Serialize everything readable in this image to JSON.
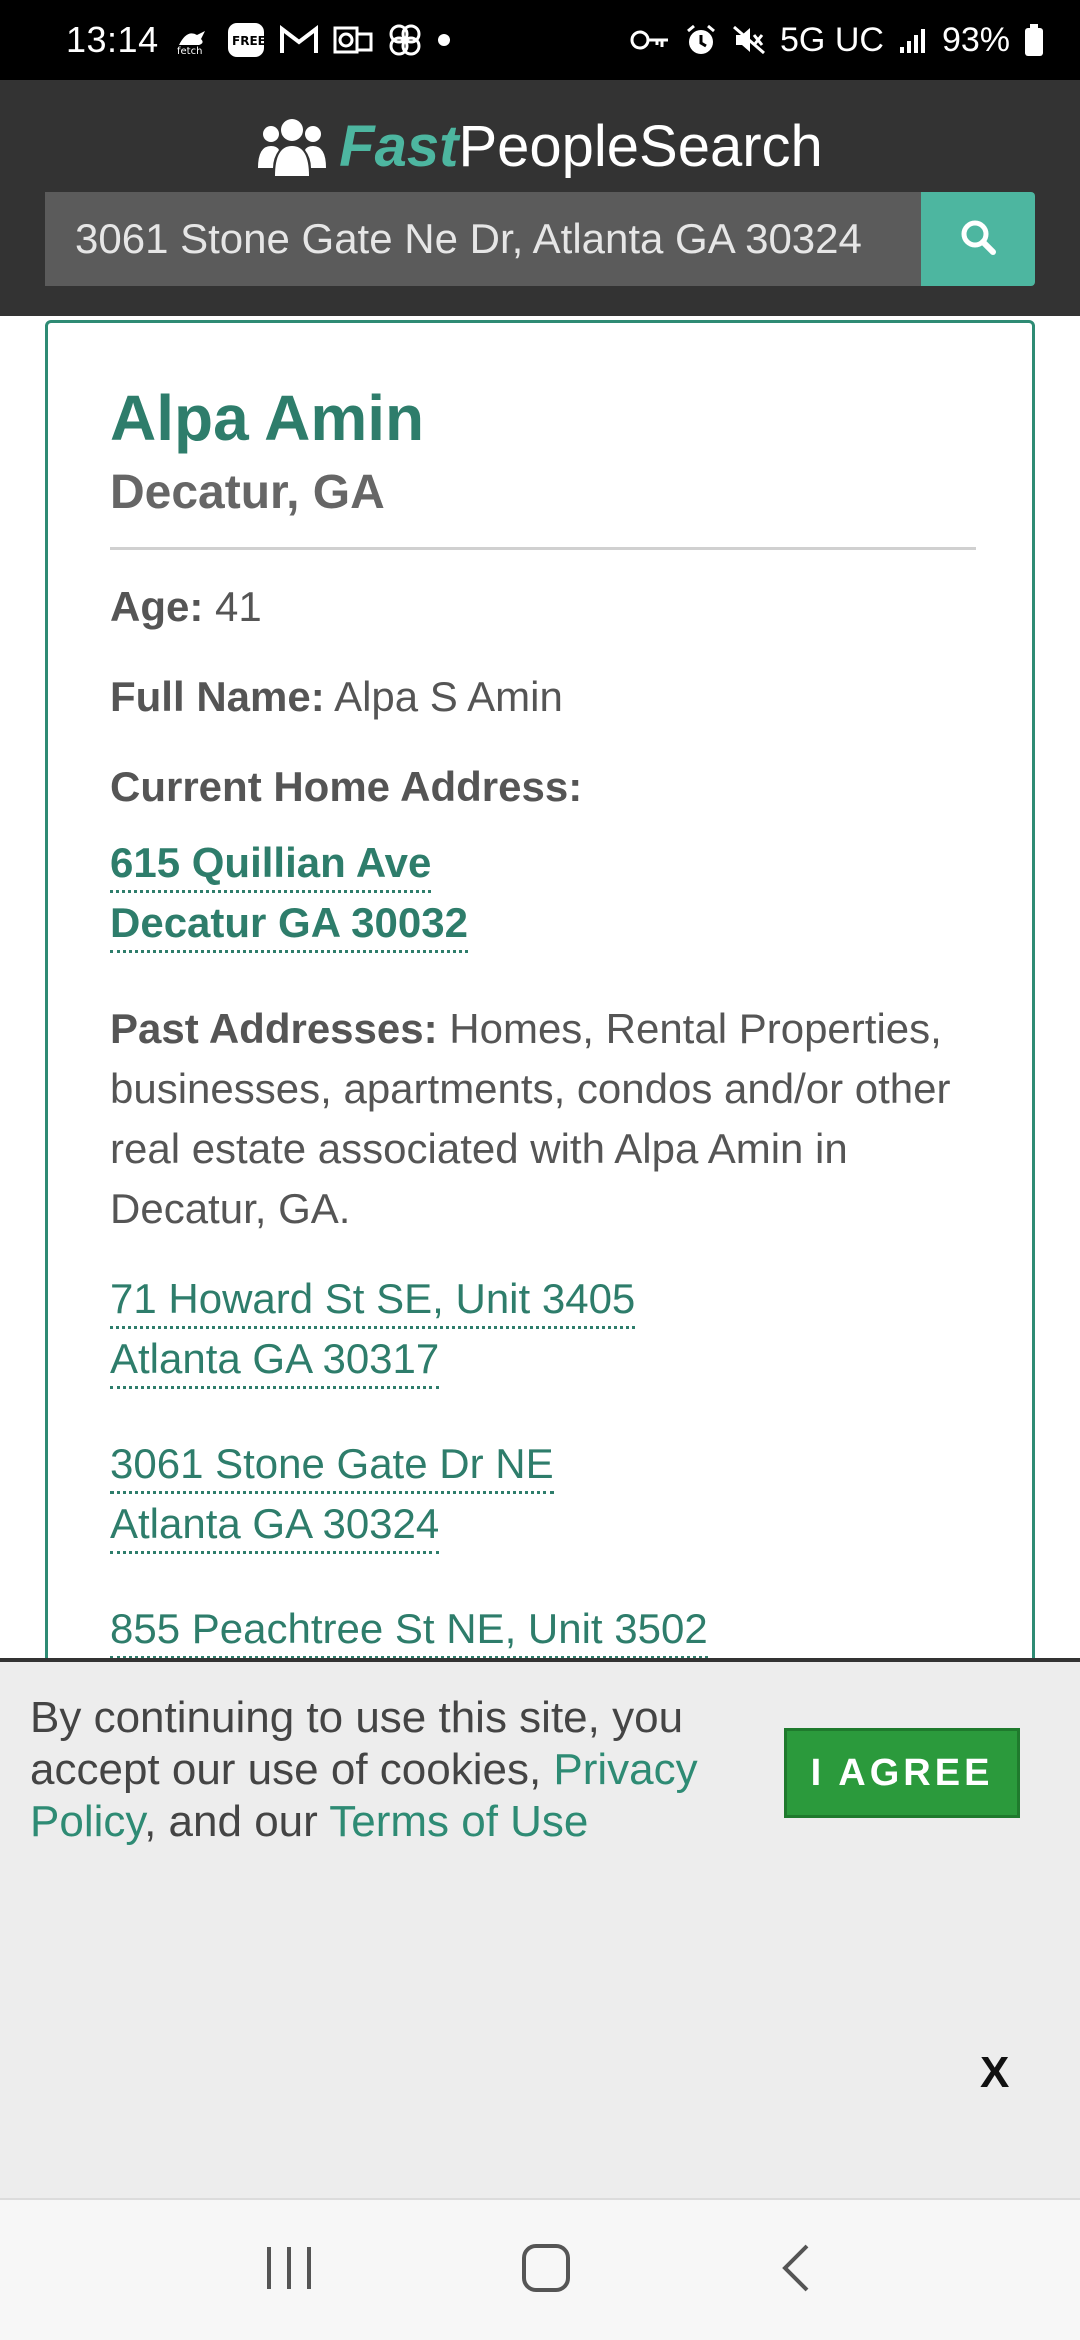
{
  "status_bar": {
    "time": "13:14",
    "left_icons": [
      "fetch-icon",
      "free-icon",
      "gmail-icon",
      "outlook-icon",
      "pinwheel-icon",
      "dot-icon"
    ],
    "network": "5G UC",
    "battery": "93%"
  },
  "header": {
    "logo_fast": "Fast",
    "logo_people": "PeopleSearch",
    "search_value": "3061 Stone Gate Ne Dr, Atlanta GA 30324"
  },
  "person": {
    "name": "Alpa Amin",
    "location": "Decatur, GA",
    "age_label": "Age:",
    "age_value": "41",
    "fullname_label": "Full Name:",
    "fullname_value": "Alpa S Amin",
    "current_address_label": "Current Home Address:",
    "current_address_line1": "615 Quillian Ave",
    "current_address_line2": "Decatur GA 30032",
    "past_label": "Past Addresses:",
    "past_text": "Homes, Rental Properties, businesses, apartments, condos and/or other real estate associated with Alpa Amin in Decatur, GA.",
    "past_addresses": [
      {
        "line1": "71 Howard St SE, Unit 3405",
        "line2": "Atlanta GA 30317"
      },
      {
        "line1": "3061 Stone Gate Dr NE",
        "line2": "Atlanta GA 30324"
      },
      {
        "line1": "855 Peachtree St NE, Unit 3502",
        "line2": ""
      }
    ]
  },
  "cookie": {
    "text_before": "By continuing to use this site, you accept our use of cookies, ",
    "privacy_link": "Privacy Policy",
    "text_middle": ", and our ",
    "terms_link": "Terms of Use",
    "agree_label": "I AGREE",
    "close_label": "X"
  },
  "navbar": {
    "icons": [
      "recent-apps-icon",
      "home-icon",
      "back-icon"
    ]
  },
  "colors": {
    "accent": "#4db6a0",
    "link": "#2e7d6b",
    "header_bg": "#333333",
    "agree_bg": "#2b9a3c"
  }
}
